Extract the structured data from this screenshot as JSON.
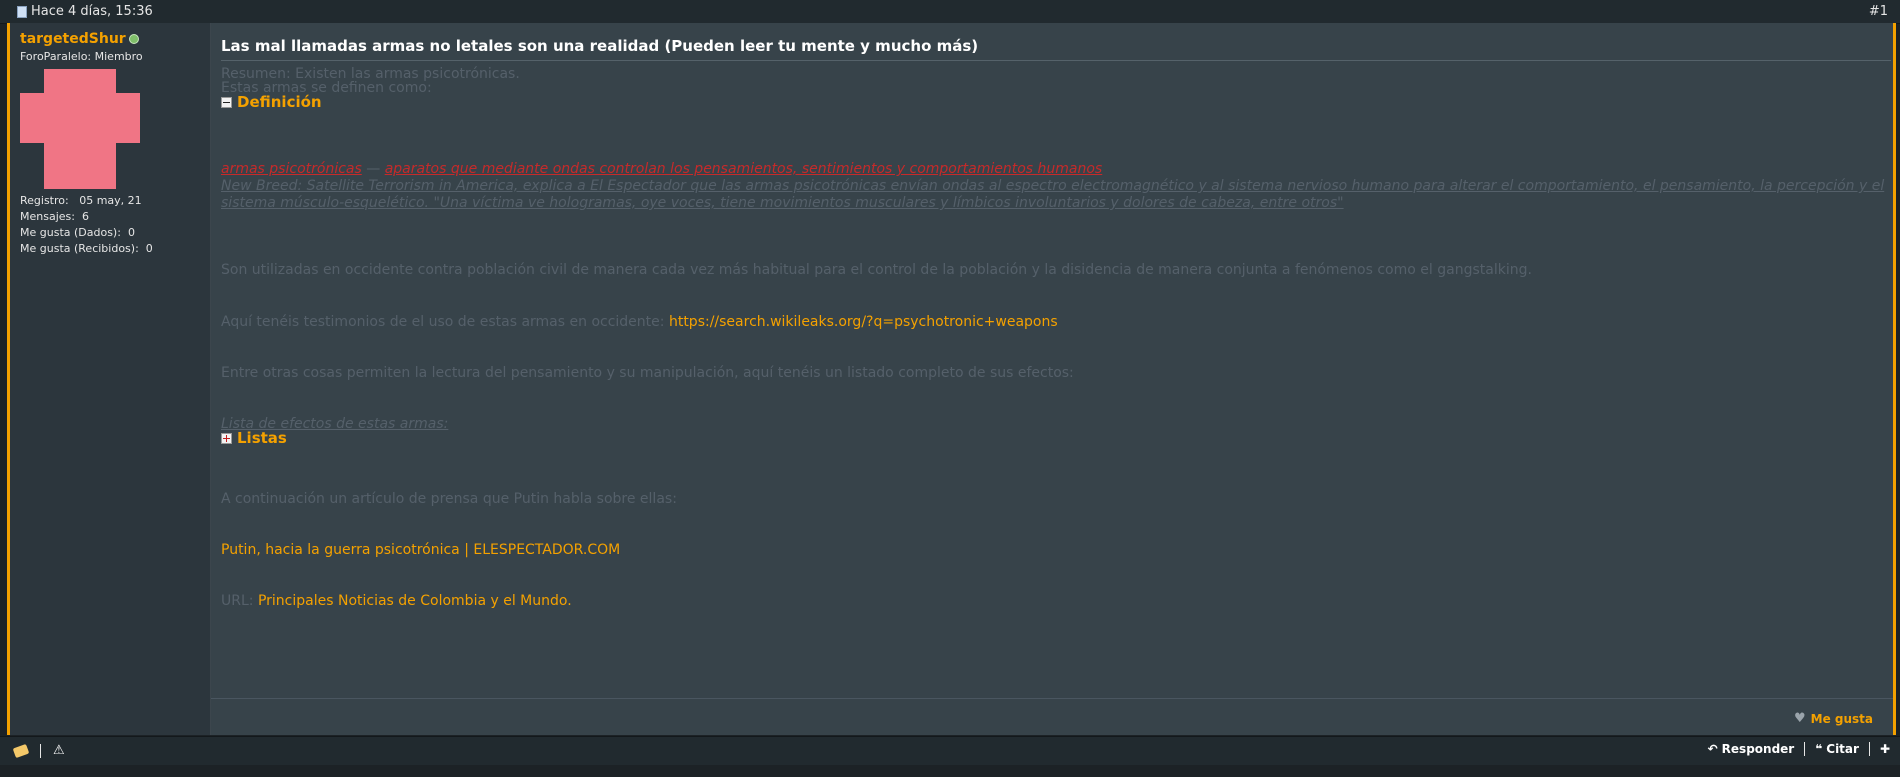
{
  "header": {
    "date": "Hace 4 días, 15:36",
    "post_number": "#1"
  },
  "author": {
    "username": "targetedShur",
    "rank": "ForoParalelo: Miembro",
    "stats": [
      {
        "label": "Registro:",
        "value": "05 may, 21"
      },
      {
        "label": "Mensajes:",
        "value": "6"
      },
      {
        "label": "Me gusta (Dados):",
        "value": "0"
      },
      {
        "label": "Me gusta (Recibidos):",
        "value": "0"
      }
    ]
  },
  "post": {
    "title": "Las mal llamadas armas no letales son una realidad (Pueden leer tu mente y mucho más)",
    "intro1": "Resumen: Existen las armas psicotrónicas.",
    "intro2": "Estas armas se definen como:",
    "spoiler1": "Definición",
    "def_term": "armas psicotrónicas",
    "def_dash": " — ",
    "def_text": "aparatos que mediante ondas controlan los pensamientos, sentimientos y comportamientos humanos",
    "quote": "New Breed: Satellite Terrorism in America, explica a El Espectador que las armas psicotrónicas envían ondas al espectro electromagnético y al sistema nervioso humano para alterar el comportamiento, el pensamiento, la percepción y el sistema músculo-esquelético. \"Una víctima ve hologramas, oye voces, tiene movimientos musculares y límbicos involuntarios y dolores de cabeza, entre otros\"",
    "para1": "Son utilizadas en occidente contra población civil de manera cada vez más habitual para el control de la población y la disidencia de manera conjunta a fenómenos como el gangstalking.",
    "para2": "Aquí tenéis testimonios de el uso de estas armas en occidente:",
    "link1": "https://search.wikileaks.org/?q=psychotronic+weapons",
    "para3": "Entre otras cosas permiten la lectura del pensamiento y su manipulación, aquí tenéis un listado completo de sus efectos:",
    "list_heading": "Lista de efectos de estas armas:",
    "spoiler2": "Listas",
    "para4": "A continuación un artículo de prensa que Putin habla sobre ellas:",
    "link2": "Putin, hacia la guerra psicotrónica | ELESPECTADOR.COM",
    "url_label": "URL:",
    "link3": "Principales Noticias de Colombia y el Mundo."
  },
  "actions": {
    "like": "Me gusta",
    "reply": "Responder",
    "quote": "Citar"
  },
  "colors": {
    "accent": "#f4a100",
    "link_red": "#c62a2a",
    "post_bg": "#37434a",
    "sidebar_bg": "#2c363d"
  }
}
